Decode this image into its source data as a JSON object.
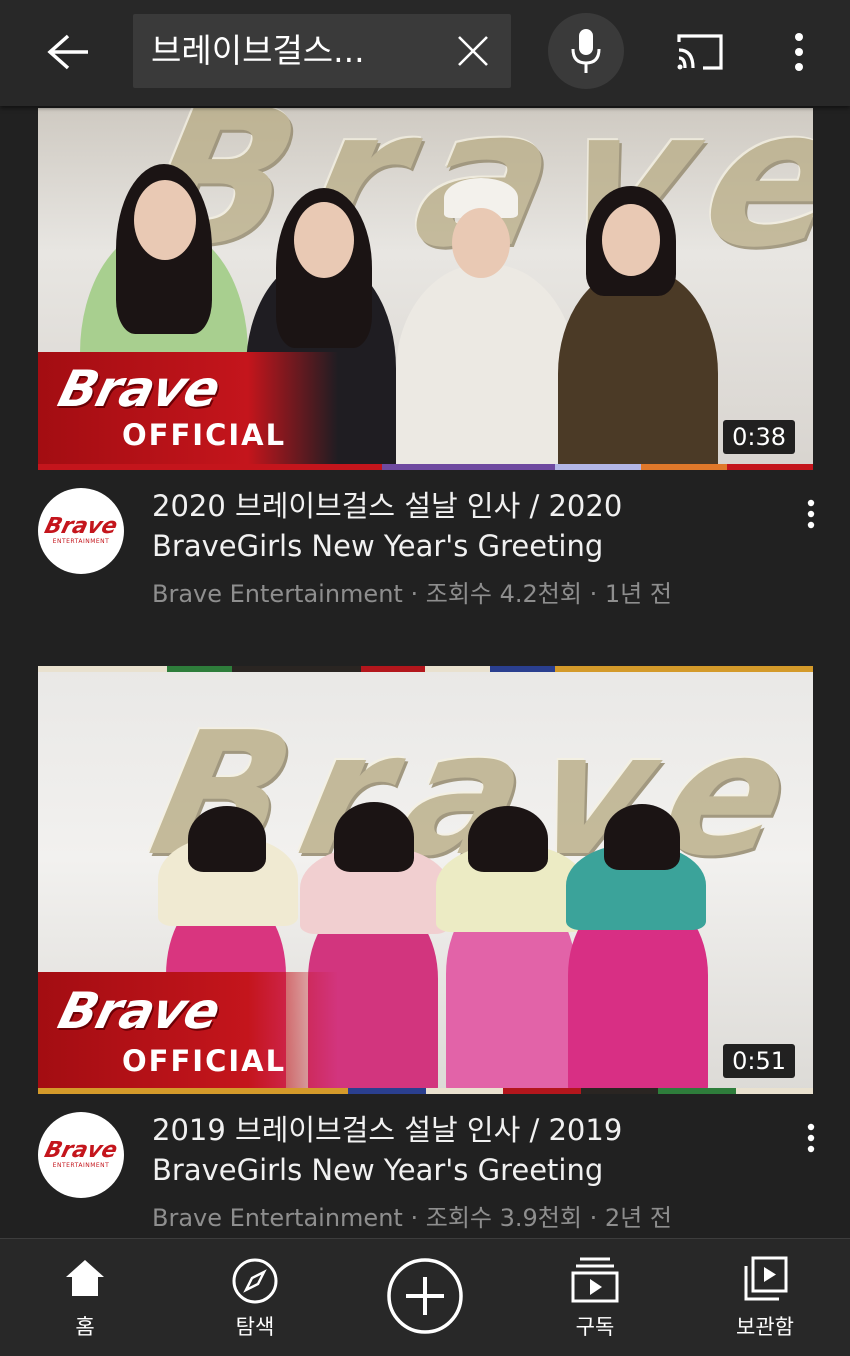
{
  "search": {
    "query": "브레이브걸스..."
  },
  "videos": [
    {
      "title": "2020 브레이브걸스 설날 인사 / 2020 BraveGirls New Year's Greeting",
      "channel": "Brave Entertainment",
      "views": "조회수 4.2천회",
      "age": "1년 전",
      "duration": "0:38",
      "thumb_logo": "Brave",
      "thumb_label": "OFFICIAL"
    },
    {
      "title": "2019 브레이브걸스 설날 인사 / 2019 BraveGirls New Year's Greeting",
      "channel": "Brave Entertainment",
      "views": "조회수 3.9천회",
      "age": "2년 전",
      "duration": "0:51",
      "thumb_logo": "Brave",
      "thumb_label": "OFFICIAL"
    }
  ],
  "channel_avatar": {
    "logo": "Brave",
    "sub": "ENTERTAINMENT"
  },
  "separator": "·",
  "nav": [
    {
      "label": "홈",
      "icon": "home-icon"
    },
    {
      "label": "탐색",
      "icon": "compass-icon"
    },
    {
      "label": "",
      "icon": "add-circle-icon"
    },
    {
      "label": "구독",
      "icon": "subscriptions-icon"
    },
    {
      "label": "보관함",
      "icon": "library-icon"
    }
  ],
  "colors": {
    "background": "#212121",
    "topbar": "#282828",
    "brand_red": "#c4151c",
    "secondary_text": "#8e8e8e"
  }
}
